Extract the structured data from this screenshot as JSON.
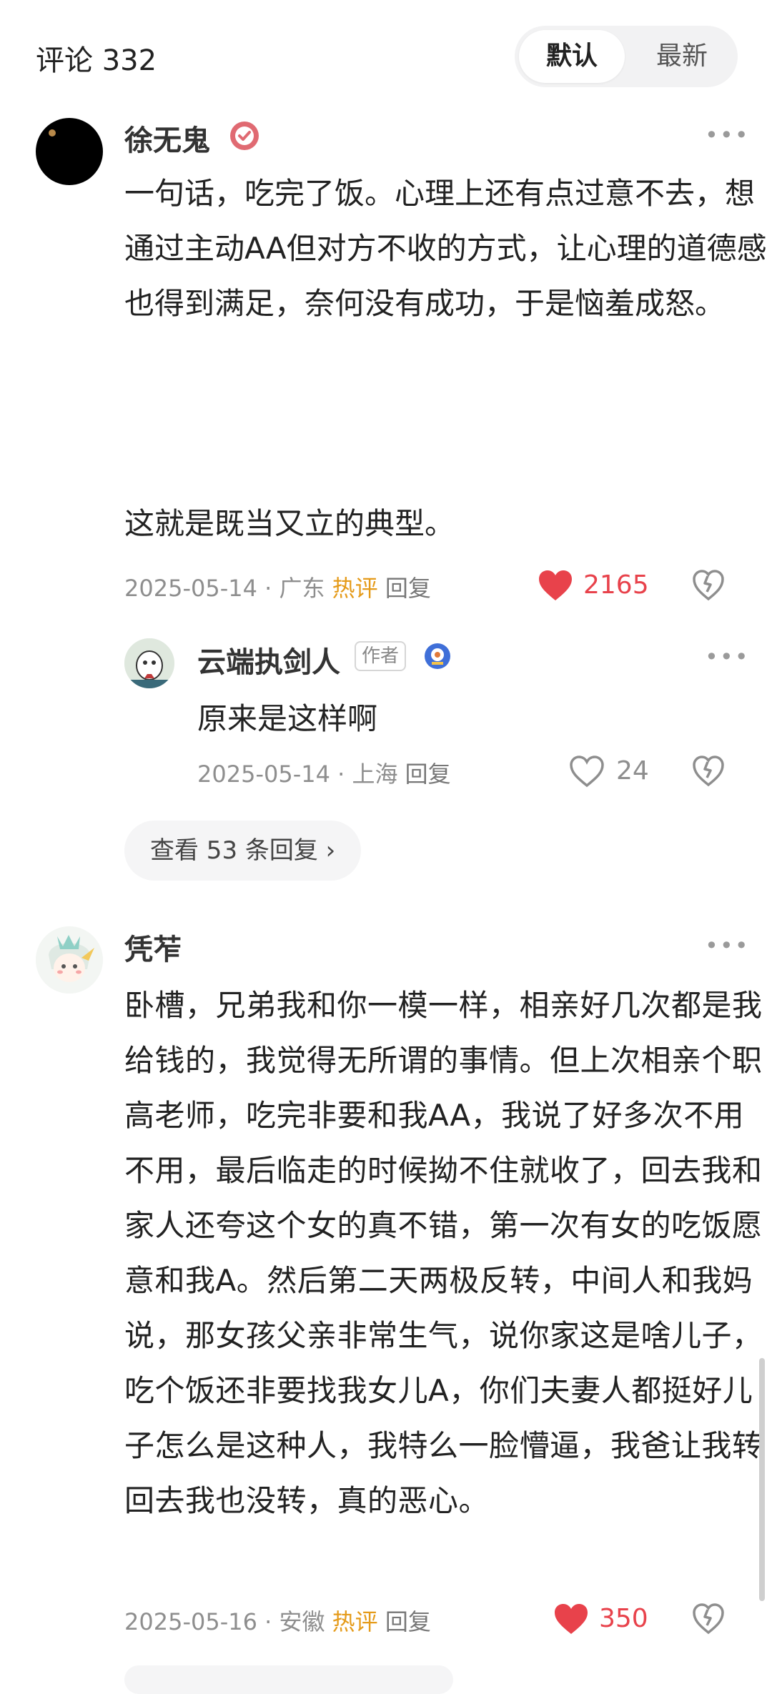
{
  "header": {
    "title": "评论 332",
    "tab_default": "默认",
    "tab_latest": "最新"
  },
  "comments": [
    {
      "username": "徐无鬼",
      "body": "一句话，吃完了饭。心理上还有点过意不去，想通过主动AA但对方不收的方式，让心理的道德感也得到满足，奈何没有成功，于是恼羞成怒。",
      "body2": "这就是既当又立的典型。",
      "date": "2025-05-14",
      "location": "广东",
      "hot": "热评",
      "reply": "回复",
      "likes": "2165"
    },
    {
      "username": "凭苲",
      "body": "卧槽，兄弟我和你一模一样，相亲好几次都是我给钱的，我觉得无所谓的事情。但上次相亲个职高老师，吃完非要和我AA，我说了好多次不用不用，最后临走的时候拗不住就收了，回去我和家人还夸这个女的真不错，第一次有女的吃饭愿意和我A。然后第二天两极反转，中间人和我妈说，那女孩父亲非常生气，说你家这是啥儿子，吃个饭还非要找我女儿A，你们夫妻人都挺好儿子怎么是这种人，我特么一脸懵逼，我爸让我转回去我也没转，真的恶心。",
      "date": "2025-05-16",
      "location": "安徽",
      "hot": "热评",
      "reply": "回复",
      "likes": "350"
    }
  ],
  "sub_reply": {
    "username": "云端执剑人",
    "tag": "作者",
    "body": "原来是这样啊",
    "date": "2025-05-14",
    "location": "上海",
    "reply": "回复",
    "likes": "24"
  },
  "view_replies": "查看 53 条回复 ›",
  "colors": {
    "accent_red": "#e8424b",
    "hot_orange": "#e59b1a",
    "meta_gray": "#8e8e8e"
  },
  "icons": [
    "verified-badge-icon",
    "more-icon",
    "heart-filled-icon",
    "heart-outline-icon",
    "dislike-icon",
    "medal-icon"
  ]
}
